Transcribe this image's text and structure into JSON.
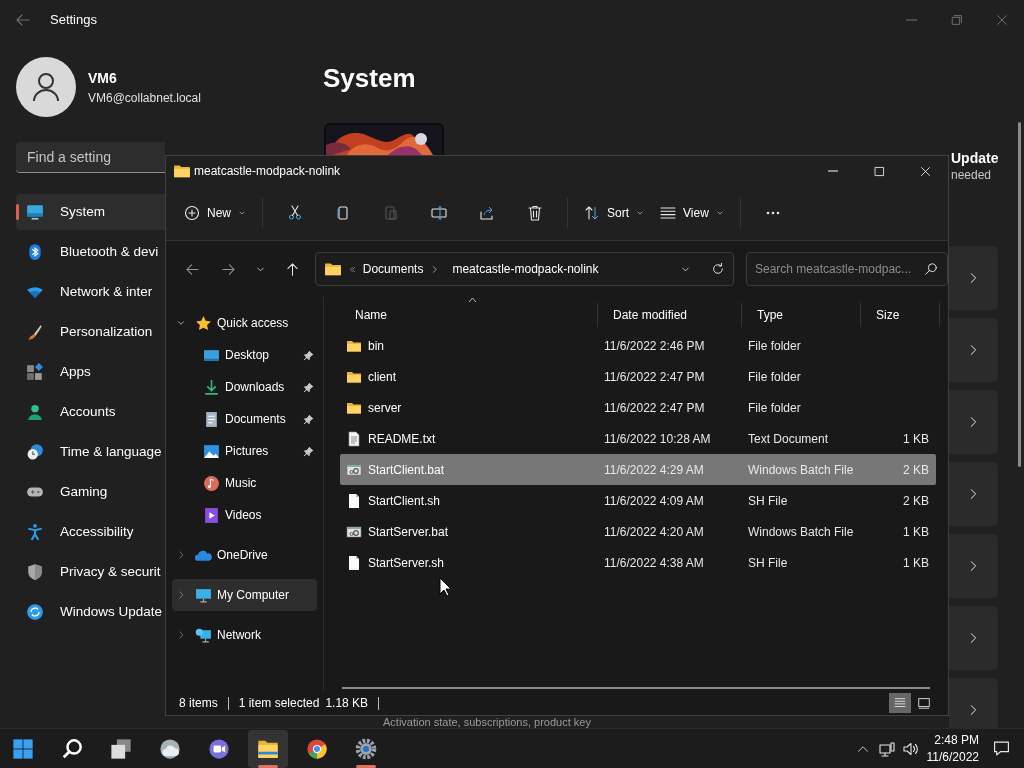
{
  "settings": {
    "title": "Settings",
    "user": {
      "name": "VM6",
      "email": "VM6@collabnet.local"
    },
    "search": {
      "placeholder": "Find a setting"
    },
    "nav": [
      {
        "kind": "system",
        "label": "System",
        "selected": true
      },
      {
        "kind": "bluetooth",
        "label": "Bluetooth & devi",
        "selected": false
      },
      {
        "kind": "network",
        "label": "Network & inter",
        "selected": false
      },
      {
        "kind": "personalization",
        "label": "Personalization",
        "selected": false
      },
      {
        "kind": "apps",
        "label": "Apps",
        "selected": false
      },
      {
        "kind": "accounts",
        "label": "Accounts",
        "selected": false
      },
      {
        "kind": "time",
        "label": "Time & language",
        "selected": false
      },
      {
        "kind": "gaming",
        "label": "Gaming",
        "selected": false
      },
      {
        "kind": "accessibility",
        "label": "Accessibility",
        "selected": false
      },
      {
        "kind": "privacy",
        "label": "Privacy & securit",
        "selected": false
      },
      {
        "kind": "update",
        "label": "Windows Update",
        "selected": false
      }
    ],
    "heading": "System",
    "update_card": {
      "title": "Update",
      "subtitle": "needed"
    },
    "activation_text": "Activation state, subscriptions, product key"
  },
  "explorer": {
    "title": "meatcastle-modpack-nolink",
    "toolbar": [
      {
        "kind": "new",
        "label": "New",
        "disabled": false
      },
      {
        "kind": "cut",
        "disabled": false
      },
      {
        "kind": "copy",
        "disabled": false
      },
      {
        "kind": "paste",
        "disabled": true
      },
      {
        "kind": "rename",
        "disabled": false
      },
      {
        "kind": "share",
        "disabled": false
      },
      {
        "kind": "delete",
        "disabled": false
      },
      {
        "kind": "sort",
        "label": "Sort",
        "disabled": false
      },
      {
        "kind": "view",
        "label": "View",
        "disabled": false
      },
      {
        "kind": "more",
        "disabled": false
      }
    ],
    "address": [
      "Documents",
      "meatcastle-modpack-nolink"
    ],
    "search": {
      "placeholder": "Search meatcastle-modpac..."
    },
    "tree": [
      {
        "kind": "quick",
        "label": "Quick access",
        "expanded": true,
        "selected": false,
        "children": [
          {
            "kind": "desktop",
            "label": "Desktop",
            "pinned": true
          },
          {
            "kind": "downloads",
            "label": "Downloads",
            "pinned": true
          },
          {
            "kind": "documents",
            "label": "Documents",
            "pinned": true
          },
          {
            "kind": "pictures",
            "label": "Pictures",
            "pinned": true
          },
          {
            "kind": "music",
            "label": "Music",
            "pinned": false
          },
          {
            "kind": "videos",
            "label": "Videos",
            "pinned": false
          }
        ]
      },
      {
        "kind": "onedrive",
        "label": "OneDrive",
        "expanded": false,
        "selected": false
      },
      {
        "kind": "computer",
        "label": "My Computer",
        "expanded": false,
        "selected": true
      },
      {
        "kind": "network",
        "label": "Network",
        "expanded": false,
        "selected": false
      }
    ],
    "columns": [
      {
        "label": "Name",
        "sorted": true
      },
      {
        "label": "Date modified",
        "sorted": false
      },
      {
        "label": "Type",
        "sorted": false
      },
      {
        "label": "Size",
        "sorted": false
      }
    ],
    "rows": [
      {
        "kind": "folder",
        "name": "bin",
        "date": "11/6/2022 2:46 PM",
        "type": "File folder",
        "selected": false
      },
      {
        "kind": "folder",
        "name": "client",
        "date": "11/6/2022 2:47 PM",
        "type": "File folder",
        "selected": false
      },
      {
        "kind": "folder",
        "name": "server",
        "date": "11/6/2022 2:47 PM",
        "type": "File folder",
        "selected": false
      },
      {
        "kind": "text",
        "name": "README.txt",
        "date": "11/6/2022 10:28 AM",
        "type": "Text Document",
        "size": "1 KB",
        "selected": false
      },
      {
        "kind": "batch",
        "name": "StartClient.bat",
        "date": "11/6/2022 4:29 AM",
        "type": "Windows Batch File",
        "size": "2 KB",
        "selected": true
      },
      {
        "kind": "file",
        "name": "StartClient.sh",
        "date": "11/6/2022 4:09 AM",
        "type": "SH File",
        "size": "2 KB",
        "selected": false
      },
      {
        "kind": "batch",
        "name": "StartServer.bat",
        "date": "11/6/2022 4:20 AM",
        "type": "Windows Batch File",
        "size": "1 KB",
        "selected": false
      },
      {
        "kind": "file",
        "name": "StartServer.sh",
        "date": "11/6/2022 4:38 AM",
        "type": "SH File",
        "size": "1 KB",
        "selected": false
      }
    ],
    "status": [
      "8 items",
      "1 item selected",
      "1.18 KB"
    ],
    "view_modes": [
      {
        "kind": "details",
        "selected": true
      },
      {
        "kind": "tiles",
        "selected": false
      }
    ]
  },
  "taskbar": {
    "apps": [
      {
        "kind": "start",
        "open": false,
        "focused": false
      },
      {
        "kind": "search",
        "open": false,
        "focused": false
      },
      {
        "kind": "taskview",
        "open": false,
        "focused": false
      },
      {
        "kind": "widgets",
        "open": false,
        "focused": false
      },
      {
        "kind": "chat",
        "open": false,
        "focused": false
      },
      {
        "kind": "explorer",
        "open": true,
        "focused": true
      },
      {
        "kind": "browser",
        "open": false,
        "focused": false
      },
      {
        "kind": "settings",
        "open": true,
        "focused": false
      }
    ],
    "time": "2:48 PM",
    "date": "11/6/2022"
  }
}
